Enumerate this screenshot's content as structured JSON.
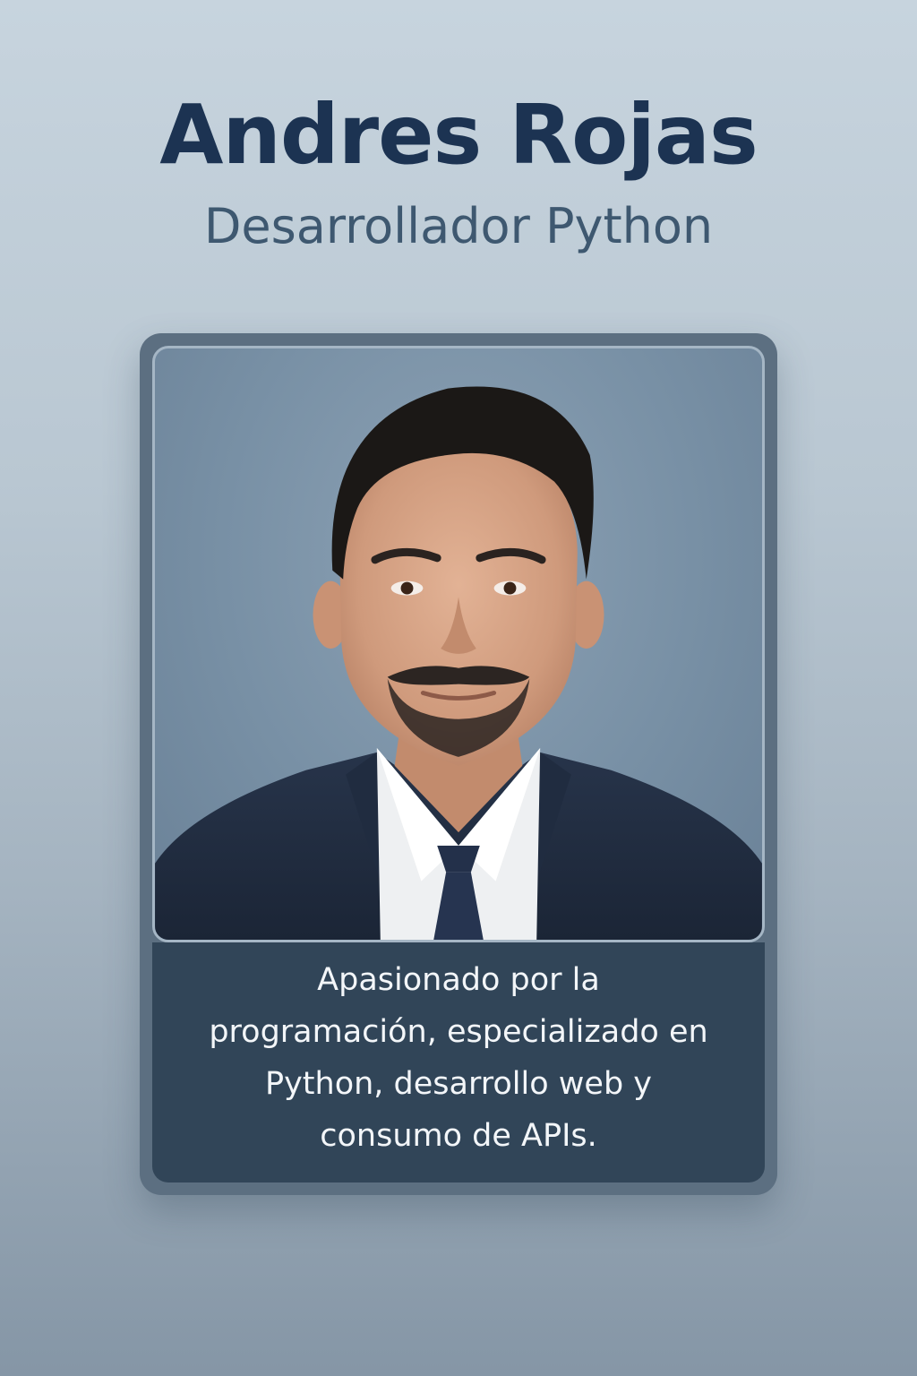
{
  "profile": {
    "name": "Andres Rojas",
    "role": "Desarrollador Python",
    "bio": "Apasionado por la programación, especializado en Python, desarrollo web y consumo de APIs."
  },
  "colors": {
    "name": "#1c3352",
    "role": "#3e5870",
    "card": "#5c6f81",
    "bio_panel": "#314558",
    "bio_text": "#f3f6f9"
  }
}
